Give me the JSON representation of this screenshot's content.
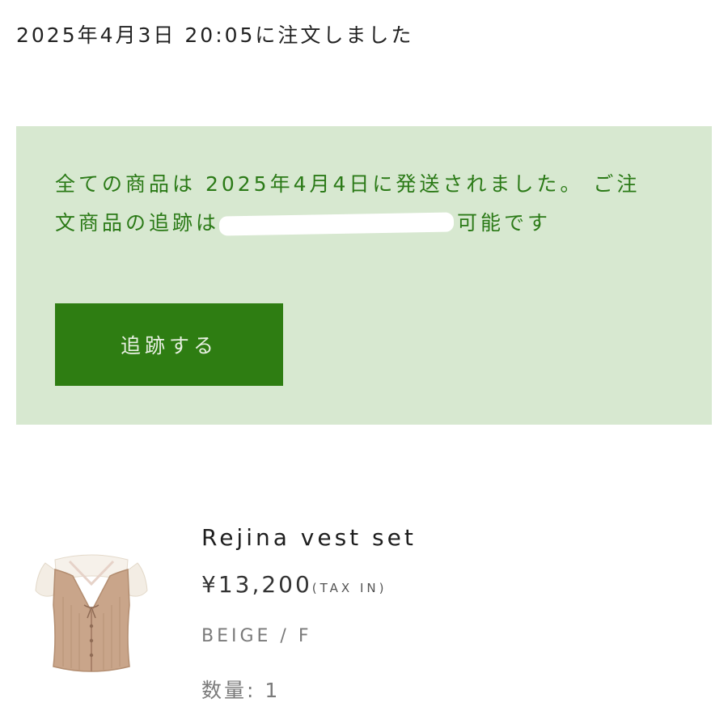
{
  "order": {
    "date_text": "2025年4月3日 20:05に注文しました"
  },
  "notice": {
    "line_before_redaction": "全ての商品は 2025年4月4日に発送されました。 ご注文商品の追跡は",
    "line_after_redaction": "可能です",
    "track_button_label": "追跡する",
    "background_color": "#d7e8d0",
    "text_color": "#2b7a17",
    "button_color": "#2e7d12"
  },
  "product": {
    "name": "Rejina vest set",
    "price": "¥13,200",
    "tax_note": "(TAX IN)",
    "variant": "BEIGE / F",
    "quantity_text": "数量: 1",
    "thumbnail_icon": "vest-set-thumbnail"
  }
}
